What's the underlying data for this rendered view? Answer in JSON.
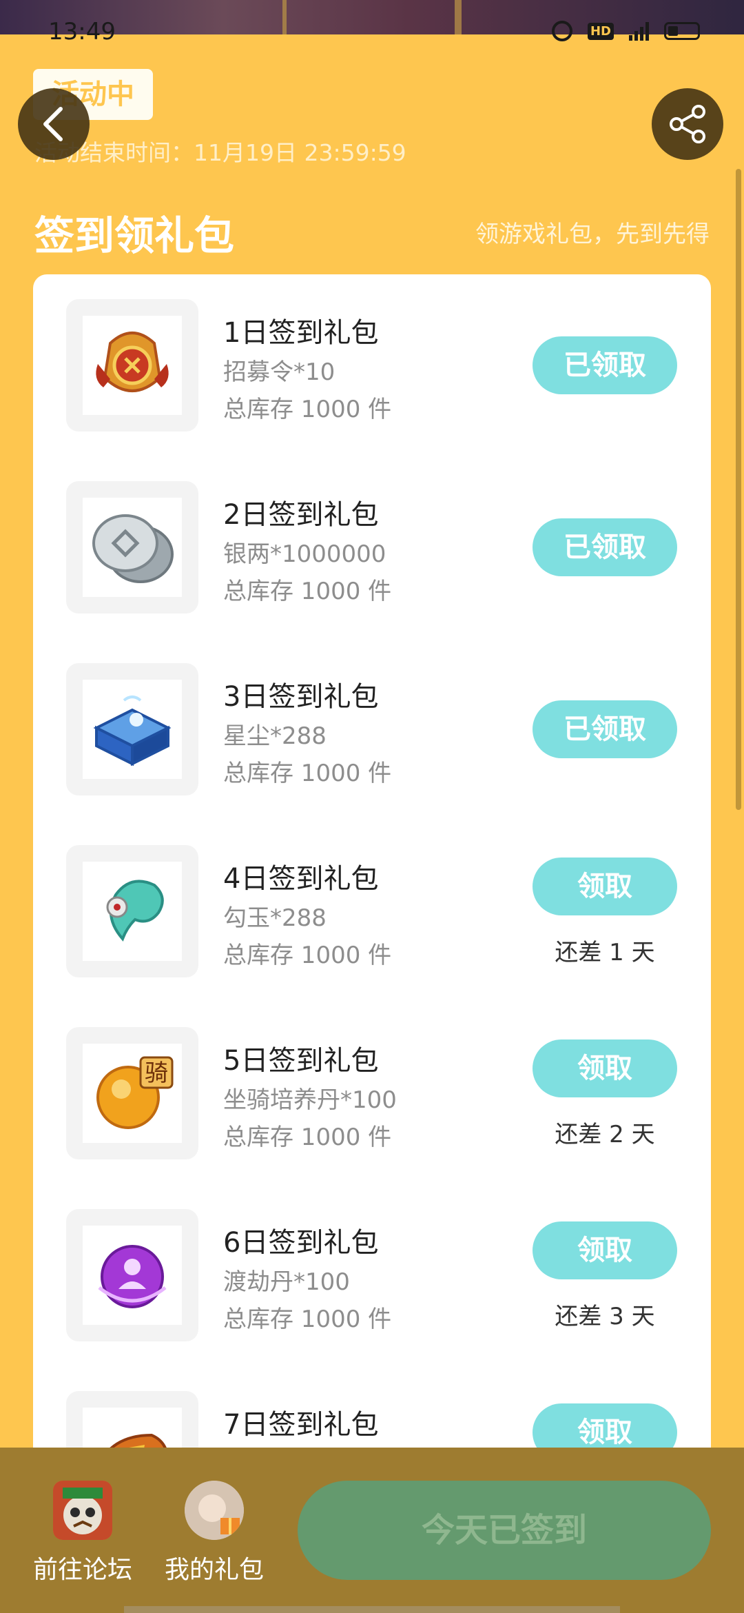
{
  "status_bar": {
    "time": "13:49",
    "hd_label": "HD"
  },
  "header": {
    "badge": "活动中",
    "end_time": "活动结束时间：11月19日 23:59:59",
    "title": "签到领礼包",
    "subtitle": "领游戏礼包，先到先得"
  },
  "gifts": [
    {
      "name": "1日签到礼包",
      "item": "招募令*10",
      "stock": "总库存 1000 件",
      "button": "已领取",
      "remaining": "",
      "icon": "recruit-token-icon"
    },
    {
      "name": "2日签到礼包",
      "item": "银两*1000000",
      "stock": "总库存 1000 件",
      "button": "已领取",
      "remaining": "",
      "icon": "silver-coins-icon"
    },
    {
      "name": "3日签到礼包",
      "item": "星尘*288",
      "stock": "总库存 1000 件",
      "button": "已领取",
      "remaining": "",
      "icon": "stardust-chest-icon"
    },
    {
      "name": "4日签到礼包",
      "item": "勾玉*288",
      "stock": "总库存 1000 件",
      "button": "领取",
      "remaining": "还差 1 天",
      "icon": "magatama-icon"
    },
    {
      "name": "5日签到礼包",
      "item": "坐骑培养丹*100",
      "stock": "总库存 1000 件",
      "button": "领取",
      "remaining": "还差 2 天",
      "icon": "mount-pill-icon"
    },
    {
      "name": "6日签到礼包",
      "item": "渡劫丹*100",
      "stock": "总库存 1000 件",
      "button": "领取",
      "remaining": "还差 3 天",
      "icon": "tribulation-pill-icon"
    },
    {
      "name": "7日签到礼包",
      "item": "",
      "stock": "",
      "button": "领取",
      "remaining": "",
      "icon": "gem-item-icon"
    }
  ],
  "bottom": {
    "forum_label": "前往论坛",
    "my_gifts_label": "我的礼包",
    "signed_label": "今天已签到",
    "badge_char": "骑"
  }
}
